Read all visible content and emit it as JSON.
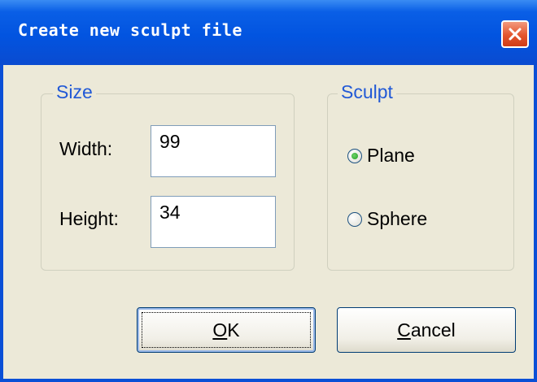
{
  "window": {
    "title": "Create new sculpt file"
  },
  "size_group": {
    "legend": "Size",
    "width_label": "Width:",
    "width_value": "99",
    "height_label": "Height:",
    "height_value": "34"
  },
  "sculpt_group": {
    "legend": "Sculpt",
    "options": [
      {
        "label": "Plane",
        "selected": true
      },
      {
        "label": "Sphere",
        "selected": false
      }
    ]
  },
  "buttons": {
    "ok_mnemonic": "O",
    "ok_rest": "K",
    "cancel_mnemonic": "C",
    "cancel_rest": "ancel"
  },
  "colors": {
    "titlebar": "#0254e0",
    "close_button": "#e3552d",
    "legend_text": "#2159d6",
    "dialog_background": "#ece9d8"
  },
  "icons": {
    "close": "close-icon"
  }
}
